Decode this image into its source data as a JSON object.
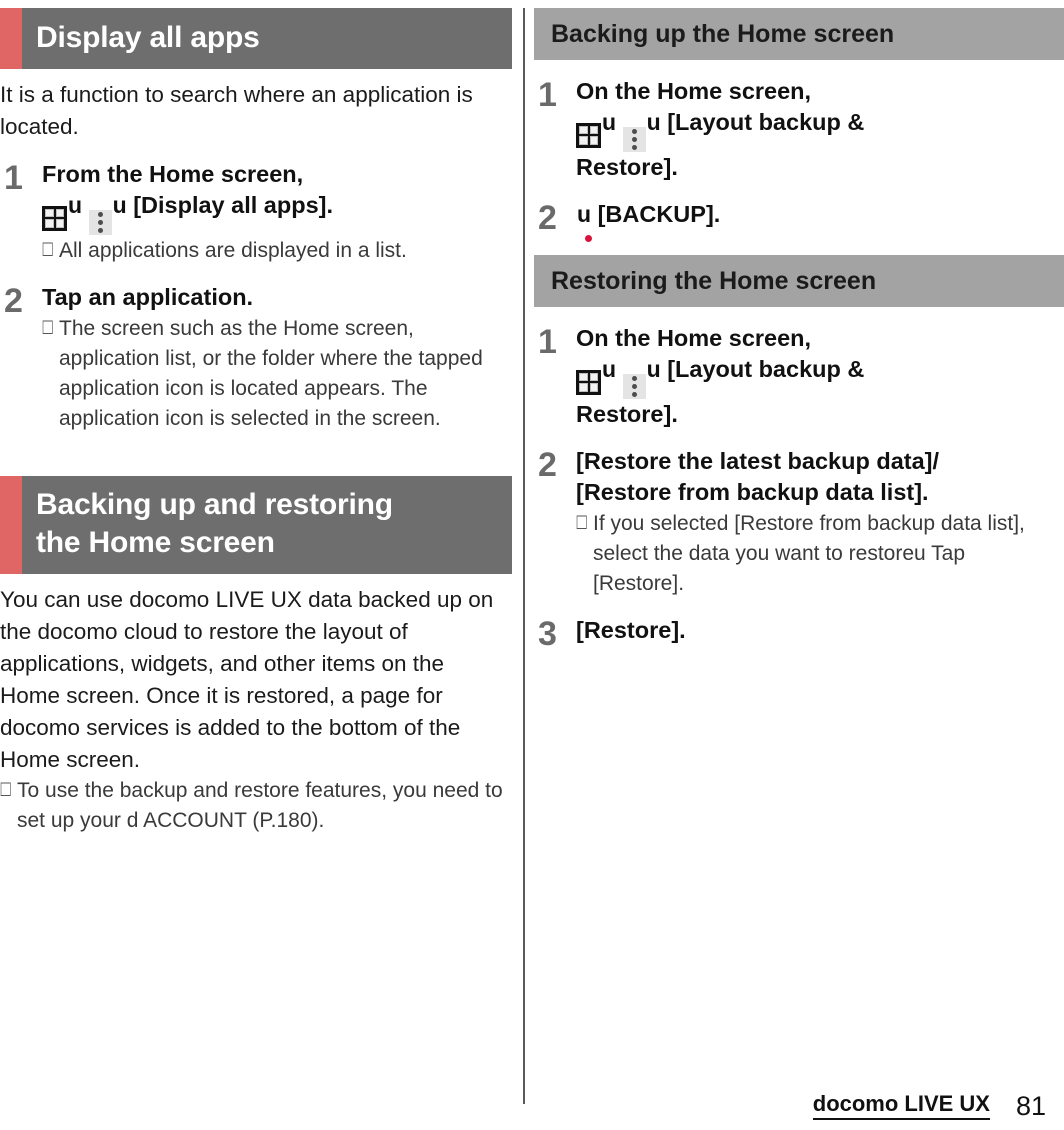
{
  "colors": {
    "accent_red": "#e06565",
    "header_gray_dark": "#6e6e6e",
    "header_gray_light": "#a3a3a3",
    "step_number_gray": "#6a6a6a",
    "app_icon_red": "#d8143c",
    "body_text": "#1b1b1b"
  },
  "left_column": {
    "section_1": {
      "heading": "Display all apps",
      "intro": "It is a function to search where an application is located.",
      "steps": [
        {
          "number": "1",
          "title_line_1": "From the Home screen,",
          "title_icons": [
            "apps-grid-icon",
            "overflow-menu-icon"
          ],
          "connector": "u",
          "title_line_2_tail": "[Display all apps].",
          "note": "All applications are displayed in a list."
        },
        {
          "number": "2",
          "title_line_1": "Tap an application.",
          "note": "The screen such as the Home screen, application list, or the folder where the tapped application icon is located appears. The application icon is selected in the screen."
        }
      ]
    },
    "section_2": {
      "heading_line_1": "Backing up and restoring",
      "heading_line_2": "the Home screen",
      "intro": "You can use docomo LIVE UX data backed up on the docomo cloud to restore the layout of applications, widgets, and other items on the Home screen. Once it is restored, a page for docomo services is added to the bottom of the Home screen.",
      "note": "To use the backup and restore features, you need to set up your d ACCOUNT (P.180)."
    }
  },
  "right_column": {
    "subsection_1": {
      "heading": "Backing up the Home screen",
      "steps": [
        {
          "number": "1",
          "title_line_1": "On the Home screen,",
          "connector": "u",
          "title_tail": "[Layout backup &",
          "title_line_3": "Restore]."
        },
        {
          "number": "2",
          "icon": "layout-backup-app-icon",
          "connector": "u",
          "title_tail": "[BACKUP]."
        }
      ]
    },
    "subsection_2": {
      "heading": "Restoring the Home screen",
      "steps": [
        {
          "number": "1",
          "title_line_1": "On the Home screen,",
          "connector": "u",
          "title_tail": "[Layout backup &",
          "title_line_3": "Restore]."
        },
        {
          "number": "2",
          "title_line_1": "[Restore the latest backup data]/",
          "title_line_2": "[Restore from backup data list].",
          "note": "If you selected [Restore from backup data list], select the data you want to restoreu Tap [Restore]."
        },
        {
          "number": "3",
          "title_line_1": "[Restore]."
        }
      ]
    }
  },
  "footer": {
    "section_title": "docomo LIVE UX",
    "page_number": "81"
  },
  "glyphs": {
    "note_box": "⎕",
    "connector": "u"
  }
}
